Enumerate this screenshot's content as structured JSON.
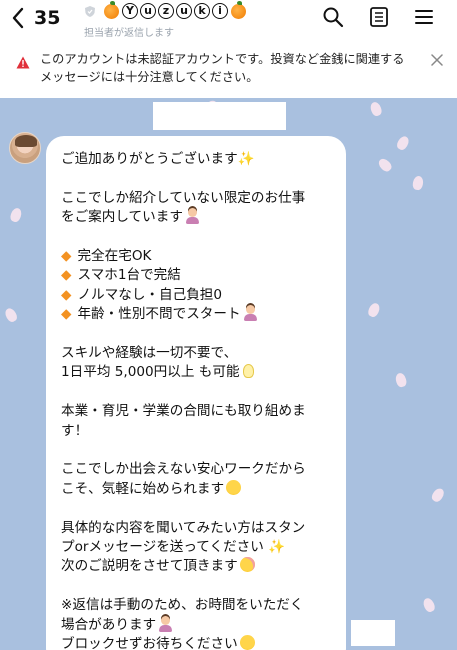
{
  "header": {
    "back_count": "35",
    "subtitle": "担当者が返信します",
    "title_letters": [
      "Y",
      "u",
      "z",
      "u",
      "k",
      "i"
    ],
    "icons": [
      "back-chevron-icon",
      "shield-icon",
      "orange-icon",
      "search-icon",
      "note-icon",
      "menu-icon"
    ]
  },
  "warning": {
    "text": "このアカウントは未認証アカウントです。投資など金銭に関連するメッセージには十分注意してください。"
  },
  "message": {
    "lines": [
      "ご追加ありがとうございます",
      "",
      "ここでしか紹介していない限定のお仕事",
      "をご案内しています",
      "",
      "完全在宅OK",
      "スマホ1台で完結",
      "ノルマなし・自己負担0",
      "年齢・性別不問でスタート",
      "",
      "スキルや経験は一切不要で、",
      "1日平均 5,000円以上 も可能",
      "",
      "本業・育児・学業の合間にも取り組めま",
      "す！",
      "",
      "ここでしか出会えない安心ワークだから",
      "こそ、気軽に始められます",
      "",
      "具体的な内容を聞いてみたい方はスタン",
      "プorメッセージを送ってください",
      "次のご説明をさせて頂きます",
      "",
      "※返信は手動のため、お時間をいただく",
      "場合があります",
      "ブロックせずお待ちください"
    ]
  },
  "colors": {
    "chat_background": "#a9c0df",
    "warning_icon": "#e0303a",
    "bullet": "#f39222"
  }
}
